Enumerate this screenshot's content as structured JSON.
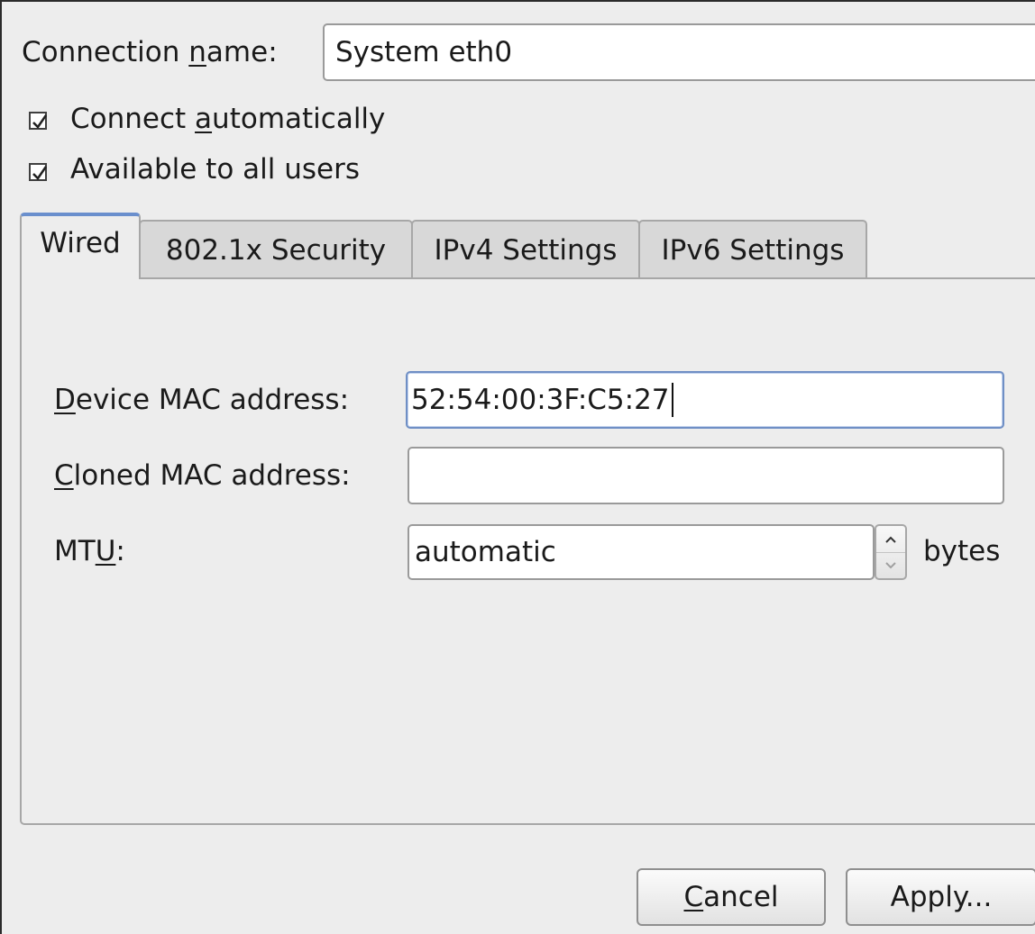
{
  "header": {
    "connection_name_label_pre": "Connection ",
    "connection_name_label_mnemonic": "n",
    "connection_name_label_post": "ame:",
    "connection_name_value": "System eth0"
  },
  "options": {
    "connect_auto_pre": "Connect ",
    "connect_auto_mnemonic": "a",
    "connect_auto_post": "utomatically",
    "connect_auto_checked": true,
    "all_users_label": "Available to all users",
    "all_users_checked": true
  },
  "tabs": [
    {
      "label": "Wired",
      "active": true
    },
    {
      "label": "802.1x Security",
      "active": false
    },
    {
      "label": "IPv4 Settings",
      "active": false
    },
    {
      "label": "IPv6 Settings",
      "active": false
    }
  ],
  "wired": {
    "device_mac_label_mnemonic": "D",
    "device_mac_label_post": "evice MAC address:",
    "device_mac_value": "52:54:00:3F:C5:27",
    "cloned_mac_label_mnemonic": "C",
    "cloned_mac_label_post": "loned MAC address:",
    "cloned_mac_value": "",
    "mtu_label_pre": "MT",
    "mtu_label_mnemonic": "U",
    "mtu_label_post": ":",
    "mtu_value": "automatic",
    "mtu_unit": "bytes"
  },
  "buttons": {
    "cancel_mnemonic": "C",
    "cancel_post": "ancel",
    "apply_label": "Apply..."
  },
  "colors": {
    "tab_active_accent": "#6a8fcd",
    "focus_border": "#6f8fc5"
  },
  "icons": {
    "checkbox_mark": "check-icon",
    "spin_up": "chevron-up-icon",
    "spin_down": "chevron-down-icon"
  }
}
